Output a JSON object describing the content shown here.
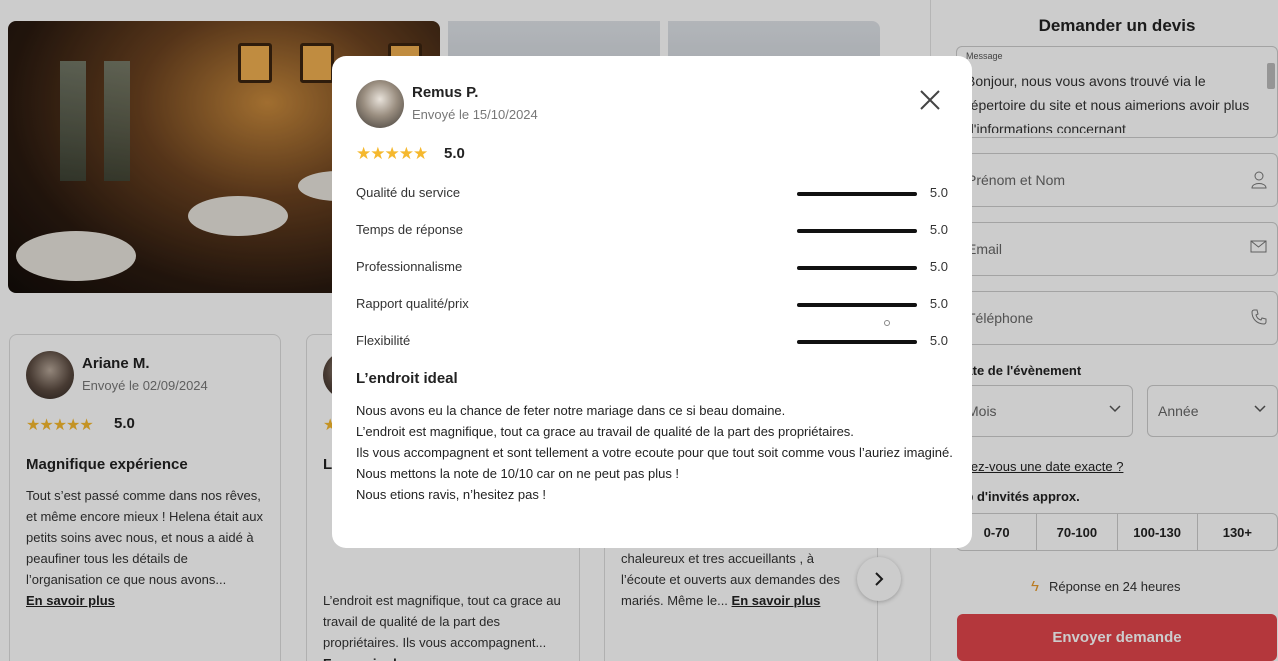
{
  "modal": {
    "reviewer": "Remus P.",
    "sent_date": "Envoyé le 15/10/2024",
    "stars": "★★★★★",
    "score": "5.0",
    "ratings": [
      {
        "label": "Qualité du service",
        "value": "5.0",
        "fill": 1.0
      },
      {
        "label": "Temps de réponse",
        "value": "5.0",
        "fill": 1.0
      },
      {
        "label": "Professionnalisme",
        "value": "5.0",
        "fill": 1.0
      },
      {
        "label": "Rapport qualité/prix",
        "value": "5.0",
        "fill": 1.0
      },
      {
        "label": "Flexibilité",
        "value": "5.0",
        "fill": 1.0
      }
    ],
    "review_title": "L’endroit ideal",
    "review_lines": [
      "Nous avons eu la chance de feter notre mariage dans ce si beau domaine.",
      "L’endroit est magnifique, tout ca grace au travail de qualité de la part des propriétaires.",
      "Ils vous accompagnent et sont tellement a votre ecoute pour que tout soit comme vous l’auriez imaginé.",
      "Nous mettons la note de 10/10 car on ne peut pas plus !",
      "Nous etions ravis, n’hesitez pas !"
    ]
  },
  "reviews": [
    {
      "name": "Ariane M.",
      "date": "Envoyé le 02/09/2024",
      "stars": "★★★★★",
      "score": "5.0",
      "title": "Magnifique expérience",
      "excerpt": "Tout s’est passé comme dans nos rêves, et même encore mieux ! Helena était aux petits soins avec nous, et nous a aidé à peaufiner tous les détails de l’organisation ce que nous avons...",
      "more": "En savoir plus"
    },
    {
      "title": "L’",
      "excerpt": "L’endroit est magnifique, tout ca grace au travail de qualité de la part des propriétaires. Ils vous accompagnent...",
      "more": "En savoir plus"
    },
    {
      "excerpt": "chaleureux et tres accueillants , à l’écoute et ouverts aux demandes des mariés. Même le...",
      "more": "En savoir plus"
    }
  ],
  "form": {
    "title": "Demander un devis",
    "message_label": "Message",
    "message_value": "Bonjour, nous vous avons trouvé via le répertoire du site et nous aimerions avoir plus d'informations concernant",
    "name_placeholder": "Prénom et Nom",
    "email_placeholder": "Email",
    "phone_placeholder": "Téléphone",
    "date_label": "Date de l'évènement",
    "month_placeholder": "Mois",
    "year_placeholder": "Année",
    "exact_date_link": "Avez-vous une date exacte ?",
    "guests_label": "Nb d'invités approx.",
    "guest_options": [
      "0-70",
      "70-100",
      "100-130",
      "130+"
    ],
    "response_time": "Réponse en 24 heures",
    "submit": "Envoyer demande"
  },
  "icons": {
    "close": "close-icon",
    "user": "user-icon",
    "mail": "mail-icon",
    "phone": "phone-icon",
    "chevron": "chevron-down-icon",
    "bolt": "lightning-icon",
    "next": "chevron-right-icon",
    "prev": "chevron-left-icon"
  },
  "colors": {
    "star": "#f5b82e",
    "accent": "#e2454c"
  }
}
